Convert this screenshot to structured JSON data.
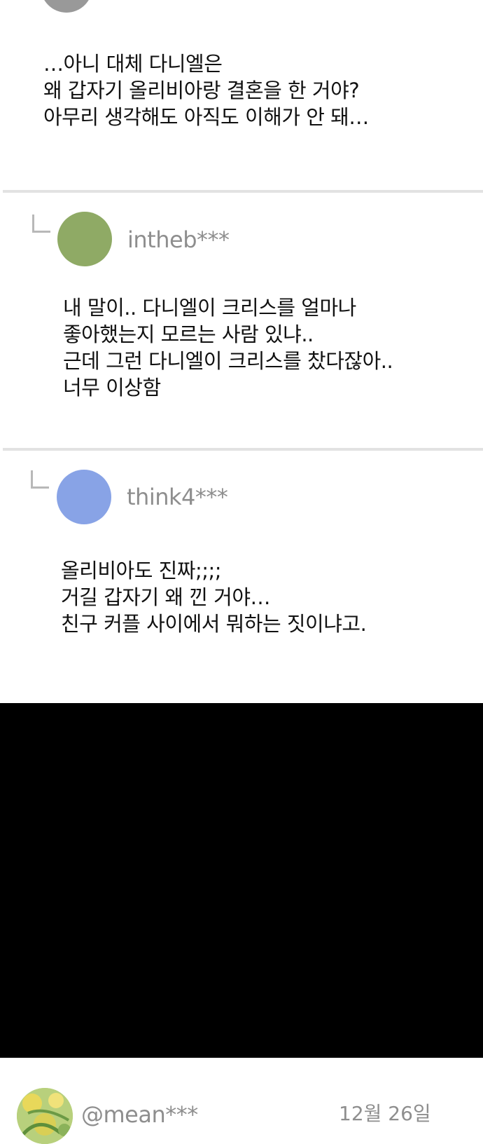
{
  "comments": [
    {
      "lines": [
        "…아니 대체 다니엘은",
        "왜 갑자기 올리비아랑 결혼을 한 거야?",
        "아무리 생각해도 아직도 이해가 안 돼…"
      ]
    },
    {
      "username": "intheb***",
      "avatar_color": "#8faa65",
      "lines": [
        "내 말이.. 다니엘이 크리스를 얼마나",
        "좋아했는지 모르는 사람 있냐..",
        "근데 그런 다니엘이 크리스를 찼다잖아..",
        "너무 이상함"
      ]
    },
    {
      "username": "think4***",
      "avatar_color": "#88a3e6",
      "lines": [
        "올리비아도 진짜;;;;",
        "거길 갑자기 왜 낀 거야…",
        "친구 커플 사이에서 뭐하는 짓이냐고."
      ]
    }
  ],
  "next_comment": {
    "username": "@mean***",
    "date": "12월 26일"
  },
  "colors": {
    "background": "#ffffff",
    "divider": "#e2e2e2",
    "username_gray": "#8e8e8e",
    "black_panel": "#000000"
  }
}
